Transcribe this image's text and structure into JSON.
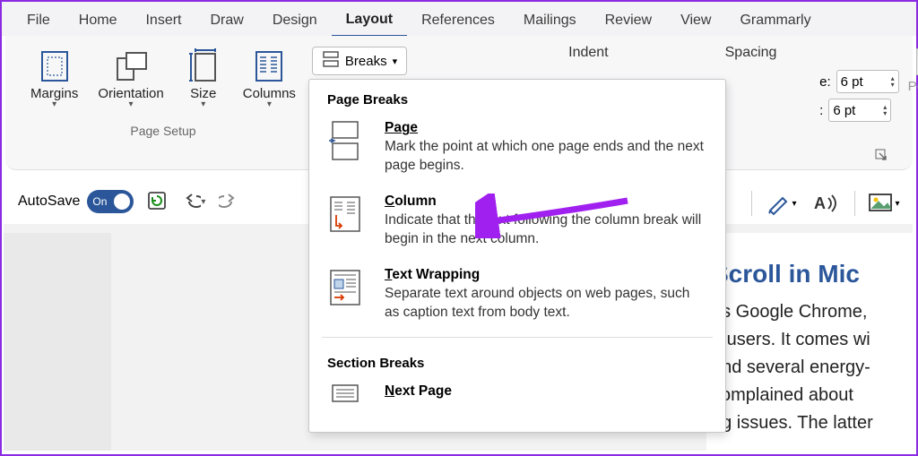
{
  "tabs": [
    "File",
    "Home",
    "Insert",
    "Draw",
    "Design",
    "Layout",
    "References",
    "Mailings",
    "Review",
    "View",
    "Grammarly"
  ],
  "active_tab": "Layout",
  "page_setup": {
    "group_label": "Page Setup",
    "buttons": {
      "margins": "Margins",
      "orientation": "Orientation",
      "size": "Size",
      "columns": "Columns"
    },
    "breaks_label": "Breaks"
  },
  "paragraph": {
    "indent_label": "Indent",
    "spacing_label": "Spacing",
    "before_label": "e:",
    "after_label": ":",
    "before_value": "6 pt",
    "after_value": "6 pt"
  },
  "arrange": {
    "position_label": "Position"
  },
  "breaks_menu": {
    "section1": "Page Breaks",
    "page": {
      "title": "Page",
      "desc": "Mark the point at which one page ends and the next page begins."
    },
    "column": {
      "title": "Column",
      "desc": "Indicate that the text following the column break will begin in the next column."
    },
    "textwrap": {
      "title": "Text Wrapping",
      "desc": "Separate text around objects on web pages, such as caption text from body text."
    },
    "section2": "Section Breaks",
    "nextpage": {
      "title": "Next Page"
    }
  },
  "autosave": {
    "label": "AutoSave",
    "state": "On"
  },
  "doc": {
    "heading": "Scroll in Mic",
    "line1": "as Google Chrome,",
    "line2": "g users. It comes wi",
    "line3": "and several energy-",
    "line4": "complained about",
    "line5": "ng issues. The latter"
  }
}
